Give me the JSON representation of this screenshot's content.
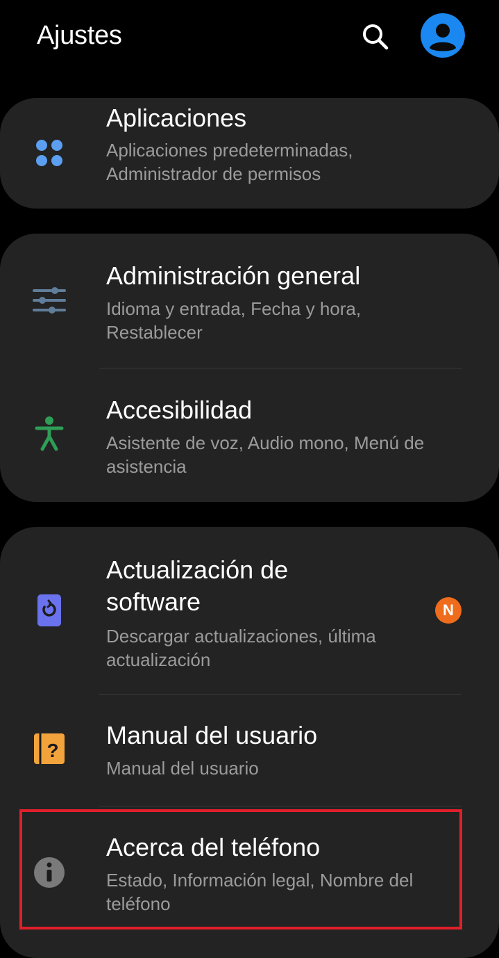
{
  "header": {
    "title": "Ajustes",
    "search_icon": "search-icon",
    "avatar_icon": "account-icon"
  },
  "colors": {
    "background": "#000000",
    "card": "#232323",
    "subtitle": "#9b9b9b",
    "apps_icon": "#5c9ef0",
    "general_icon": "#607d99",
    "accessibility_icon": "#2e9e56",
    "software_update_icon": "#6a72ee",
    "user_manual_icon": "#f2a33c",
    "about_icon": "#7a7a7a",
    "badge": "#ee6c1c",
    "highlight": "#e01f2a"
  },
  "items": {
    "apps": {
      "title": "Aplicaciones",
      "subtitle": "Aplicaciones predeterminadas, Administrador de permisos",
      "icon": "apps-icon"
    },
    "general": {
      "title": "Administración general",
      "subtitle": "Idioma y entrada, Fecha y hora, Restablecer",
      "icon": "sliders-icon"
    },
    "accessibility": {
      "title": "Accesibilidad",
      "subtitle": "Asistente de voz, Audio mono, Menú de asistencia",
      "icon": "accessibility-icon"
    },
    "software_update": {
      "title": "Actualización de software",
      "subtitle": "Descargar actualizaciones, última actualización",
      "icon": "update-icon",
      "badge": "N"
    },
    "user_manual": {
      "title": "Manual del usuario",
      "subtitle": "Manual del usuario",
      "icon": "help-book-icon"
    },
    "about": {
      "title": "Acerca del teléfono",
      "subtitle": "Estado, Información legal, Nombre del teléfono",
      "icon": "info-icon"
    }
  }
}
